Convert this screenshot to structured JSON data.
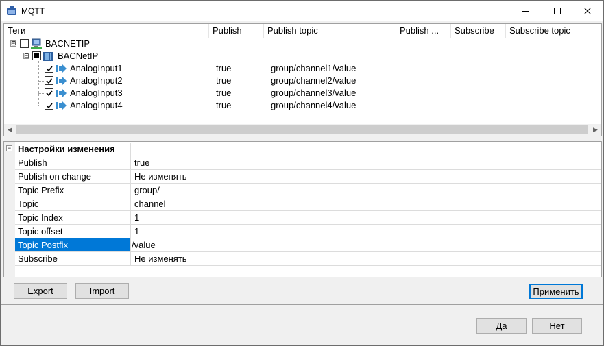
{
  "window": {
    "title": "MQTT"
  },
  "tree": {
    "columns": [
      {
        "label": "Теги"
      },
      {
        "label": "Publish"
      },
      {
        "label": "Publish topic"
      },
      {
        "label": "Publish ..."
      },
      {
        "label": "Subscribe"
      },
      {
        "label": "Subscribe topic"
      }
    ],
    "root": {
      "label": "BACNETIP",
      "expander": "⊟"
    },
    "device": {
      "label": "BACNetIP",
      "expander": "⊟"
    },
    "items": [
      {
        "label": "AnalogInput1",
        "publish": "true",
        "topic": "group/channel1/value"
      },
      {
        "label": "AnalogInput2",
        "publish": "true",
        "topic": "group/channel2/value"
      },
      {
        "label": "AnalogInput3",
        "publish": "true",
        "topic": "group/channel3/value"
      },
      {
        "label": "AnalogInput4",
        "publish": "true",
        "topic": "group/channel4/value"
      }
    ]
  },
  "props": {
    "category": "Настройки изменения",
    "rows": [
      {
        "name": "Publish",
        "value": "true"
      },
      {
        "name": "Publish on change",
        "value": "Не изменять"
      },
      {
        "name": "Topic Prefix",
        "value": "group/"
      },
      {
        "name": "Topic",
        "value": "channel"
      },
      {
        "name": "Topic Index",
        "value": "1"
      },
      {
        "name": "Topic offset",
        "value": "1"
      },
      {
        "name": "Topic Postfix",
        "value": "/value"
      },
      {
        "name": "Subscribe",
        "value": "Не изменять"
      }
    ]
  },
  "buttons": {
    "export": "Export",
    "import": "Import",
    "apply": "Применить",
    "ok": "Да",
    "cancel": "Нет"
  },
  "colors": {
    "selection": "#0078d7",
    "arrow_icon": "#3a8fd0"
  }
}
